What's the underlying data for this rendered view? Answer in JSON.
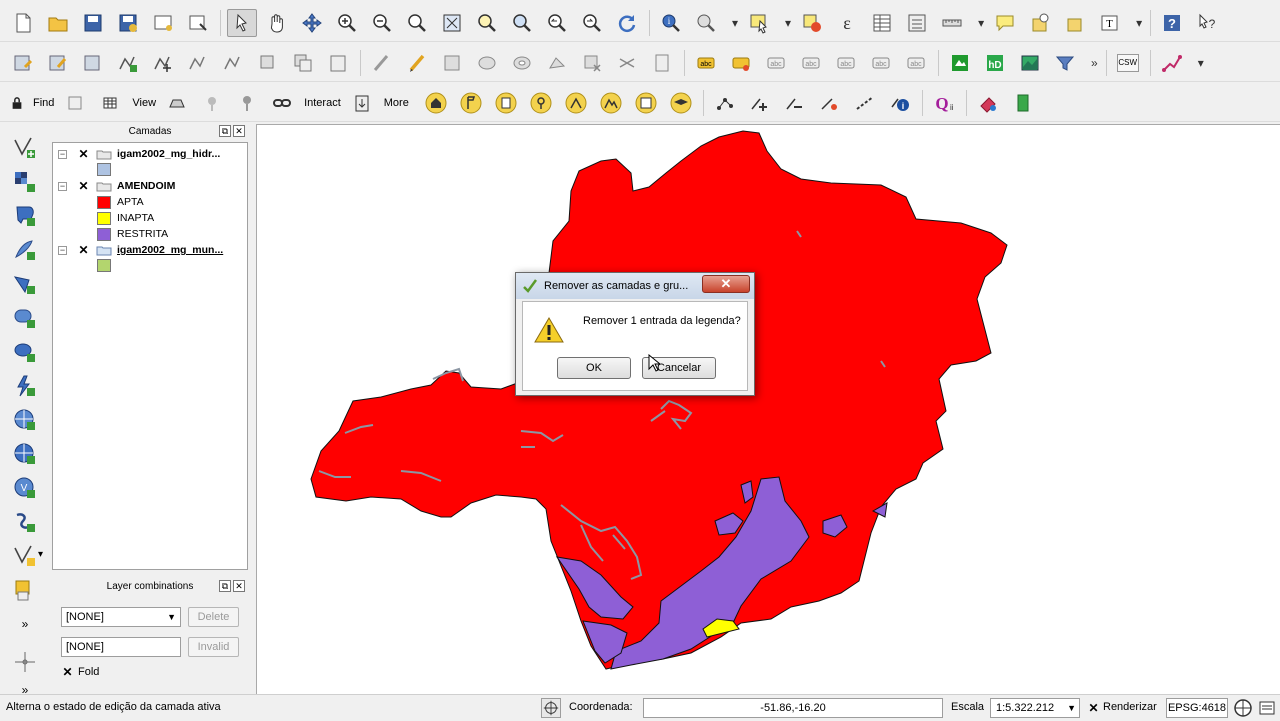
{
  "toolbar": {
    "find_label": "Find",
    "view_label": "View",
    "interact_label": "Interact",
    "more_label": "More",
    "csw_label": "CSW",
    "more_chevron": "»"
  },
  "layers_panel": {
    "title": "Camadas",
    "layers": [
      {
        "name": "igam2002_mg_hidr...",
        "checked": true,
        "swatch": "#aec3e2"
      },
      {
        "name": "AMENDOIM",
        "checked": true,
        "classes": [
          {
            "label": "APTA",
            "color": "#ff0000"
          },
          {
            "label": "INAPTA",
            "color": "#ffff00"
          },
          {
            "label": "RESTRITA",
            "color": "#8e5fd6"
          }
        ]
      },
      {
        "name": "igam2002_mg_mun...",
        "checked": true,
        "swatch": "#b3d56e"
      }
    ]
  },
  "combinations_panel": {
    "title": "Layer combinations",
    "combo_value": "[NONE]",
    "name_value": "[NONE]",
    "delete_label": "Delete",
    "invalid_label": "Invalid",
    "fold_label": "Fold"
  },
  "dialog": {
    "title": "Remover as camadas e gru...",
    "message": "Remover 1 entrada da legenda?",
    "ok_label": "OK",
    "cancel_label": "Cancelar"
  },
  "statusbar": {
    "message": "Alterna o estado de edição da camada ativa",
    "coord_label": "Coordenada:",
    "coord_value": "-51.86,-16.20",
    "scale_label": "Escala",
    "scale_value": "1:5.322.212",
    "render_label": "Renderizar",
    "epsg_label": "EPSG:4618"
  },
  "colors": {
    "apta": "#ff0000",
    "inapta": "#ffff00",
    "restrita": "#8e5fd6",
    "rivers": "#8c96a3"
  }
}
